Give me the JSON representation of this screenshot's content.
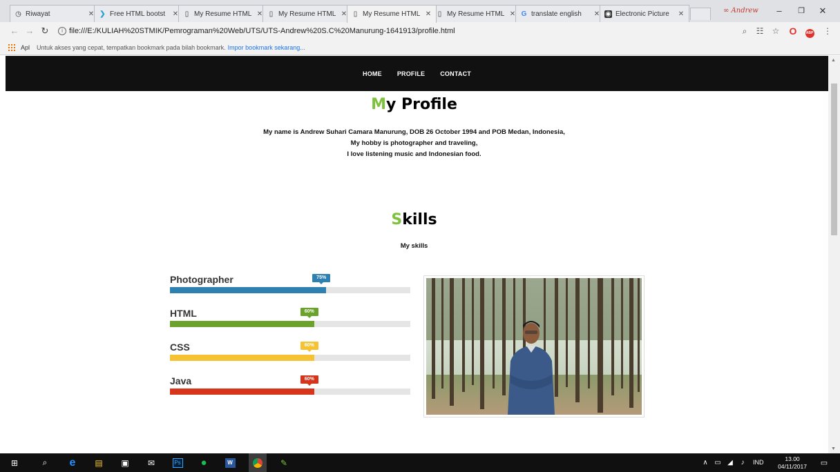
{
  "browser": {
    "tabs": [
      {
        "title": "Riwayat",
        "icon": "history-icon",
        "active": false
      },
      {
        "title": "Free HTML bootst",
        "icon": "bootstrap-icon",
        "active": false
      },
      {
        "title": "My Resume HTML",
        "icon": "page-icon",
        "active": false
      },
      {
        "title": "My Resume HTML",
        "icon": "page-icon",
        "active": false
      },
      {
        "title": "My Resume HTML",
        "icon": "page-icon",
        "active": true
      },
      {
        "title": "My Resume HTML",
        "icon": "page-icon",
        "active": false
      },
      {
        "title": "translate english",
        "icon": "google-icon",
        "active": false
      },
      {
        "title": "Electronic Picture",
        "icon": "camera-icon",
        "active": false
      }
    ],
    "profile_name": "Andrew",
    "url": "file:///E:/KULIAH%20STMIK/Pemrograman%20Web/UTS/UTS-Andrew%20S.C%20Manurung-1641913/profile.html",
    "bookmarks": {
      "apps_label": "Apl",
      "hint": "Untuk akses yang cepat, tempatkan bookmark pada bilah bookmark.",
      "import_link": "Impor bookmark sekarang..."
    }
  },
  "site": {
    "nav": [
      "HOME",
      "PROFILE",
      "CONTACT"
    ],
    "profile": {
      "title_first": "M",
      "title_rest": "y Profile",
      "lines": [
        "My name is Andrew Suhari Camara Manurung, DOB 26 October 1994 and POB Medan, Indonesia,",
        "My hobby is photographer and traveling,",
        "I love listening music and Indonesian food."
      ]
    },
    "skills": {
      "title_first": "S",
      "title_rest": "kills",
      "subtitle": "My skills",
      "items": [
        {
          "name": "Photographer",
          "percent": 65,
          "label": "75%",
          "color": "#2e80b1"
        },
        {
          "name": "HTML",
          "percent": 60,
          "label": "60%",
          "color": "#6aa22b"
        },
        {
          "name": "CSS",
          "percent": 60,
          "label": "60%",
          "color": "#f5c234"
        },
        {
          "name": "Java",
          "percent": 60,
          "label": "60%",
          "color": "#d6351c"
        }
      ]
    }
  },
  "taskbar": {
    "language": "IND",
    "time": "13.00",
    "date": "04/11/2017"
  },
  "colors": {
    "accent": "#7dc13c",
    "nav_bg": "#111111"
  }
}
